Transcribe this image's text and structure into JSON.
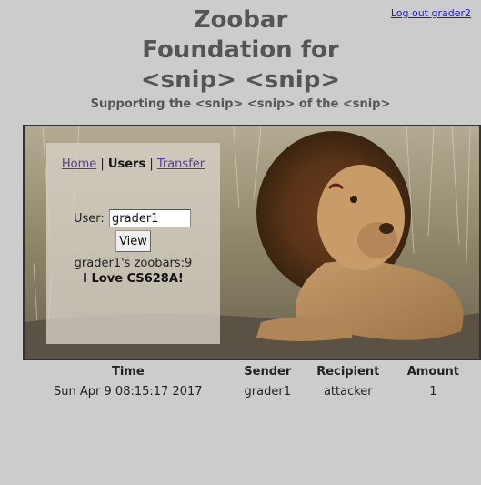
{
  "header": {
    "logout_label": "Log out grader2",
    "title_line1": "Zoobar",
    "title_line2": "Foundation for",
    "title_line3": "<snip> <snip>",
    "subtitle": "Supporting the <snip> <snip> of the <snip>"
  },
  "nav": {
    "home": "Home",
    "sep1": " | ",
    "users": "Users",
    "sep2": " | ",
    "transfer": "Transfer"
  },
  "user_form": {
    "label": "User:",
    "value": "grader1",
    "view_button": "View"
  },
  "profile": {
    "zoobars_text": "grader1's zoobars:9",
    "profile_text": "I Love CS628A!"
  },
  "transfers": {
    "columns": [
      "Time",
      "Sender",
      "Recipient",
      "Amount"
    ],
    "rows": [
      [
        "Sun Apr 9 08:15:17 2017",
        "grader1",
        "attacker",
        "1"
      ]
    ]
  },
  "colors": {
    "background": "#cccccc",
    "title": "#555555",
    "link": "#1a1ac8",
    "visited_link": "#5a3aa0"
  },
  "icons": {
    "banner_image": "lion-photo"
  }
}
